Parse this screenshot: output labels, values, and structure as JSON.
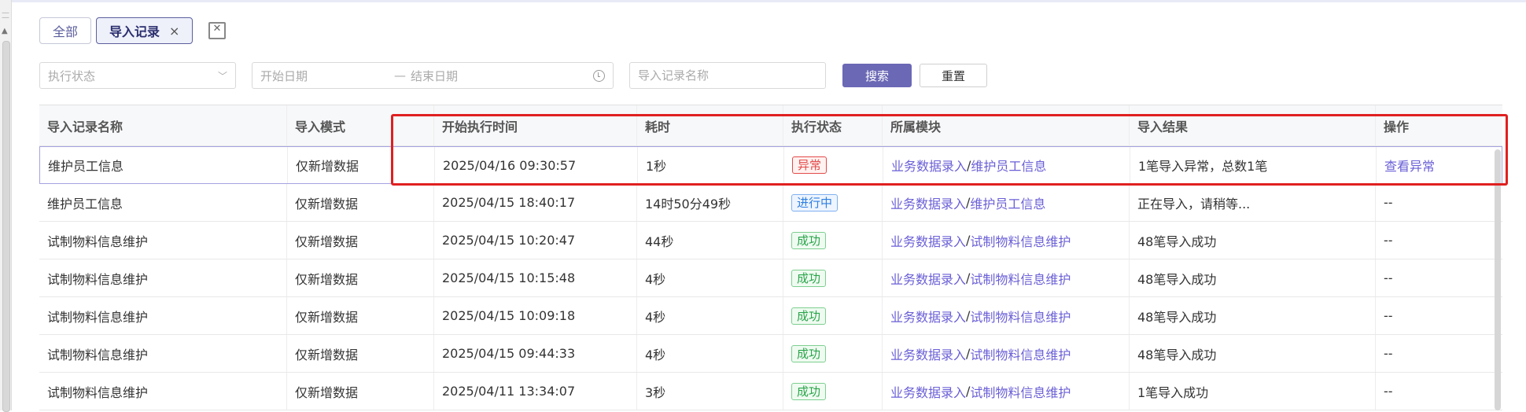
{
  "tabs": [
    {
      "label": "全部"
    },
    {
      "label": "导入记录",
      "close": "×"
    }
  ],
  "filters": {
    "status_placeholder": "执行状态",
    "start_date_placeholder": "开始日期",
    "date_separator": "—",
    "end_date_placeholder": "结束日期",
    "name_placeholder": "导入记录名称",
    "search_label": "搜索",
    "reset_label": "重置"
  },
  "table": {
    "headers": [
      "导入记录名称",
      "导入模式",
      "开始执行时间",
      "耗时",
      "执行状态",
      "所属模块",
      "导入结果",
      "操作"
    ],
    "rows": [
      {
        "name": "维护员工信息",
        "mode": "仅新增数据",
        "start": "2025/04/16 09:30:57",
        "duration": "1秒",
        "status": "异常",
        "module_a": "业务数据录入",
        "module_b": "维护员工信息",
        "result": "1笔导入异常，总数1笔",
        "action": "查看异常"
      },
      {
        "name": "维护员工信息",
        "mode": "仅新增数据",
        "start": "2025/04/15 18:40:17",
        "duration": "14时50分49秒",
        "status": "进行中",
        "module_a": "业务数据录入",
        "module_b": "维护员工信息",
        "result": "正在导入，请稍等...",
        "action": "--"
      },
      {
        "name": "试制物料信息维护",
        "mode": "仅新增数据",
        "start": "2025/04/15 10:20:47",
        "duration": "44秒",
        "status": "成功",
        "module_a": "业务数据录入",
        "module_b": "试制物料信息维护",
        "result": "48笔导入成功",
        "action": "--"
      },
      {
        "name": "试制物料信息维护",
        "mode": "仅新增数据",
        "start": "2025/04/15 10:15:48",
        "duration": "4秒",
        "status": "成功",
        "module_a": "业务数据录入",
        "module_b": "试制物料信息维护",
        "result": "48笔导入成功",
        "action": "--"
      },
      {
        "name": "试制物料信息维护",
        "mode": "仅新增数据",
        "start": "2025/04/15 10:09:18",
        "duration": "4秒",
        "status": "成功",
        "module_a": "业务数据录入",
        "module_b": "试制物料信息维护",
        "result": "48笔导入成功",
        "action": "--"
      },
      {
        "name": "试制物料信息维护",
        "mode": "仅新增数据",
        "start": "2025/04/15 09:44:33",
        "duration": "4秒",
        "status": "成功",
        "module_a": "业务数据录入",
        "module_b": "试制物料信息维护",
        "result": "48笔导入成功",
        "action": "--"
      },
      {
        "name": "试制物料信息维护",
        "mode": "仅新增数据",
        "start": "2025/04/11 13:34:07",
        "duration": "3秒",
        "status": "成功",
        "module_a": "业务数据录入",
        "module_b": "试制物料信息维护",
        "result": "1笔导入成功",
        "action": "--"
      }
    ]
  },
  "colors": {
    "accent": "#6b68b5",
    "link": "#6a5fd6",
    "error": "#e24a4a",
    "running": "#2f7fe0",
    "success": "#2aa44a",
    "highlight": "#e02020"
  }
}
